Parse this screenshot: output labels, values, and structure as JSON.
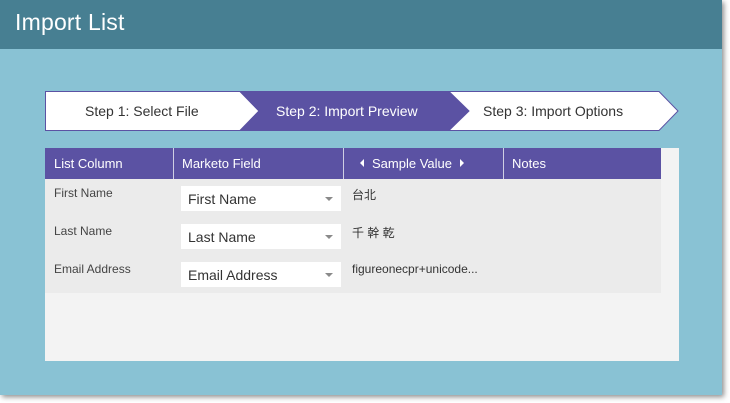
{
  "dialog": {
    "title": "Import List"
  },
  "wizard": {
    "steps": [
      {
        "label": "Step 1: Select File",
        "state": "complete"
      },
      {
        "label": "Step 2: Import Preview",
        "state": "active"
      },
      {
        "label": "Step 3: Import Options",
        "state": "upcoming"
      }
    ],
    "colors": {
      "active": "#5b52a3",
      "inactive": "#ffffff",
      "border": "#5b52a3"
    }
  },
  "table": {
    "columns": [
      "List Column",
      "Marketo Field",
      "Sample Value",
      "Notes"
    ],
    "rows": [
      {
        "list_column": "First Name",
        "marketo_field": "First Name",
        "sample_value": "台北",
        "notes": ""
      },
      {
        "list_column": "Last Name",
        "marketo_field": "Last Name",
        "sample_value": "千 幹 乾",
        "notes": ""
      },
      {
        "list_column": "Email Address",
        "marketo_field": "Email Address",
        "sample_value": "figureonecpr+unicode...",
        "notes": ""
      }
    ],
    "icons": {
      "prev": "caret-left-icon",
      "next": "caret-right-icon",
      "dropdown": "chevron-down-icon"
    }
  },
  "colors": {
    "title_bar": "#477f92",
    "background": "#89c2d4",
    "header": "#5b52a3"
  }
}
